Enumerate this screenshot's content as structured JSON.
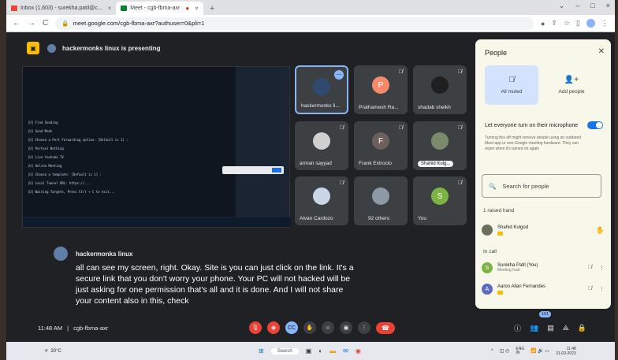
{
  "browser": {
    "tabs": [
      {
        "title": "Inbox (1,603) - surekha.patil@c...",
        "active": false
      },
      {
        "title": "Meet - cgb-fbma-axr",
        "active": true
      }
    ],
    "url": "meet.google.com/cgb-fbma-axr?authuser=0&pli=1"
  },
  "meet": {
    "presenting_text": "hackermonks linux is presenting",
    "tiles": [
      {
        "name": "hackermonks li...",
        "initial": ""
      },
      {
        "name": "Prathamesh Ra...",
        "initial": "P"
      },
      {
        "name": "shadab sheikh",
        "initial": ""
      },
      {
        "name": "arman sayyad",
        "initial": ""
      },
      {
        "name": "Frank Extrocio",
        "initial": "F"
      },
      {
        "name": "Shahid Kulg...",
        "initial": ""
      },
      {
        "name": "Alvan Cardozo",
        "initial": ""
      },
      {
        "name": "92 others",
        "initial": ""
      },
      {
        "name": "You",
        "initial": "S"
      }
    ],
    "caption_speaker": "hackermonks linux",
    "caption_text": "all can see my screen, right. Okay. Site is you can just click on the link. It's a secure link that you don't worry your phone. Your PC will not hacked will be just asking for one permission that's all and it is done. And I will not share your content also in this, check",
    "time": "11:48 AM",
    "separator": "|",
    "meeting_code": "cgb-fbma-axr",
    "participant_badge": "101"
  },
  "people_panel": {
    "title": "People",
    "all_muted_label": "All muted",
    "add_people_label": "Add people",
    "toggle_label": "Let everyone turn on their microphone",
    "toggle_desc": "Turning this off might remove people using an outdated Meet app or non-Google meeting hardware. They can rejoin when it's turned on again",
    "search_placeholder": "Search for people",
    "raised_hand_heading": "1 raised hand",
    "raised": [
      {
        "name": "Shahid Kulgod"
      }
    ],
    "in_call_heading": "In call",
    "in_call": [
      {
        "name": "Surekha Patil (You)",
        "sub": "Meeting host",
        "initial": "S",
        "color": "#7cb342"
      },
      {
        "name": "Aaron Allan Fernandes",
        "sub": "",
        "initial": "A",
        "color": "#5c6bc0"
      }
    ]
  },
  "taskbar": {
    "weather": "30°C",
    "search": "Search",
    "lang": "ENG\nIN",
    "time": "11:48",
    "date": "31-03-2023"
  },
  "terminal_lines": [
    "|U] Find Sending",
    "|U] Send Mods",
    "|U] Choose a Port Forwarding option: [Default is 1] :",
    "|U] Portsel Nothing",
    "|U] Live Youtube TV",
    "|U] Online Meeting",
    "|U] Choose a template: [Default is 1] :",
    "|U] Local Tunnel URL: https://...",
    "|U] Waiting Targets, Press Ctrl + C to exit..."
  ]
}
